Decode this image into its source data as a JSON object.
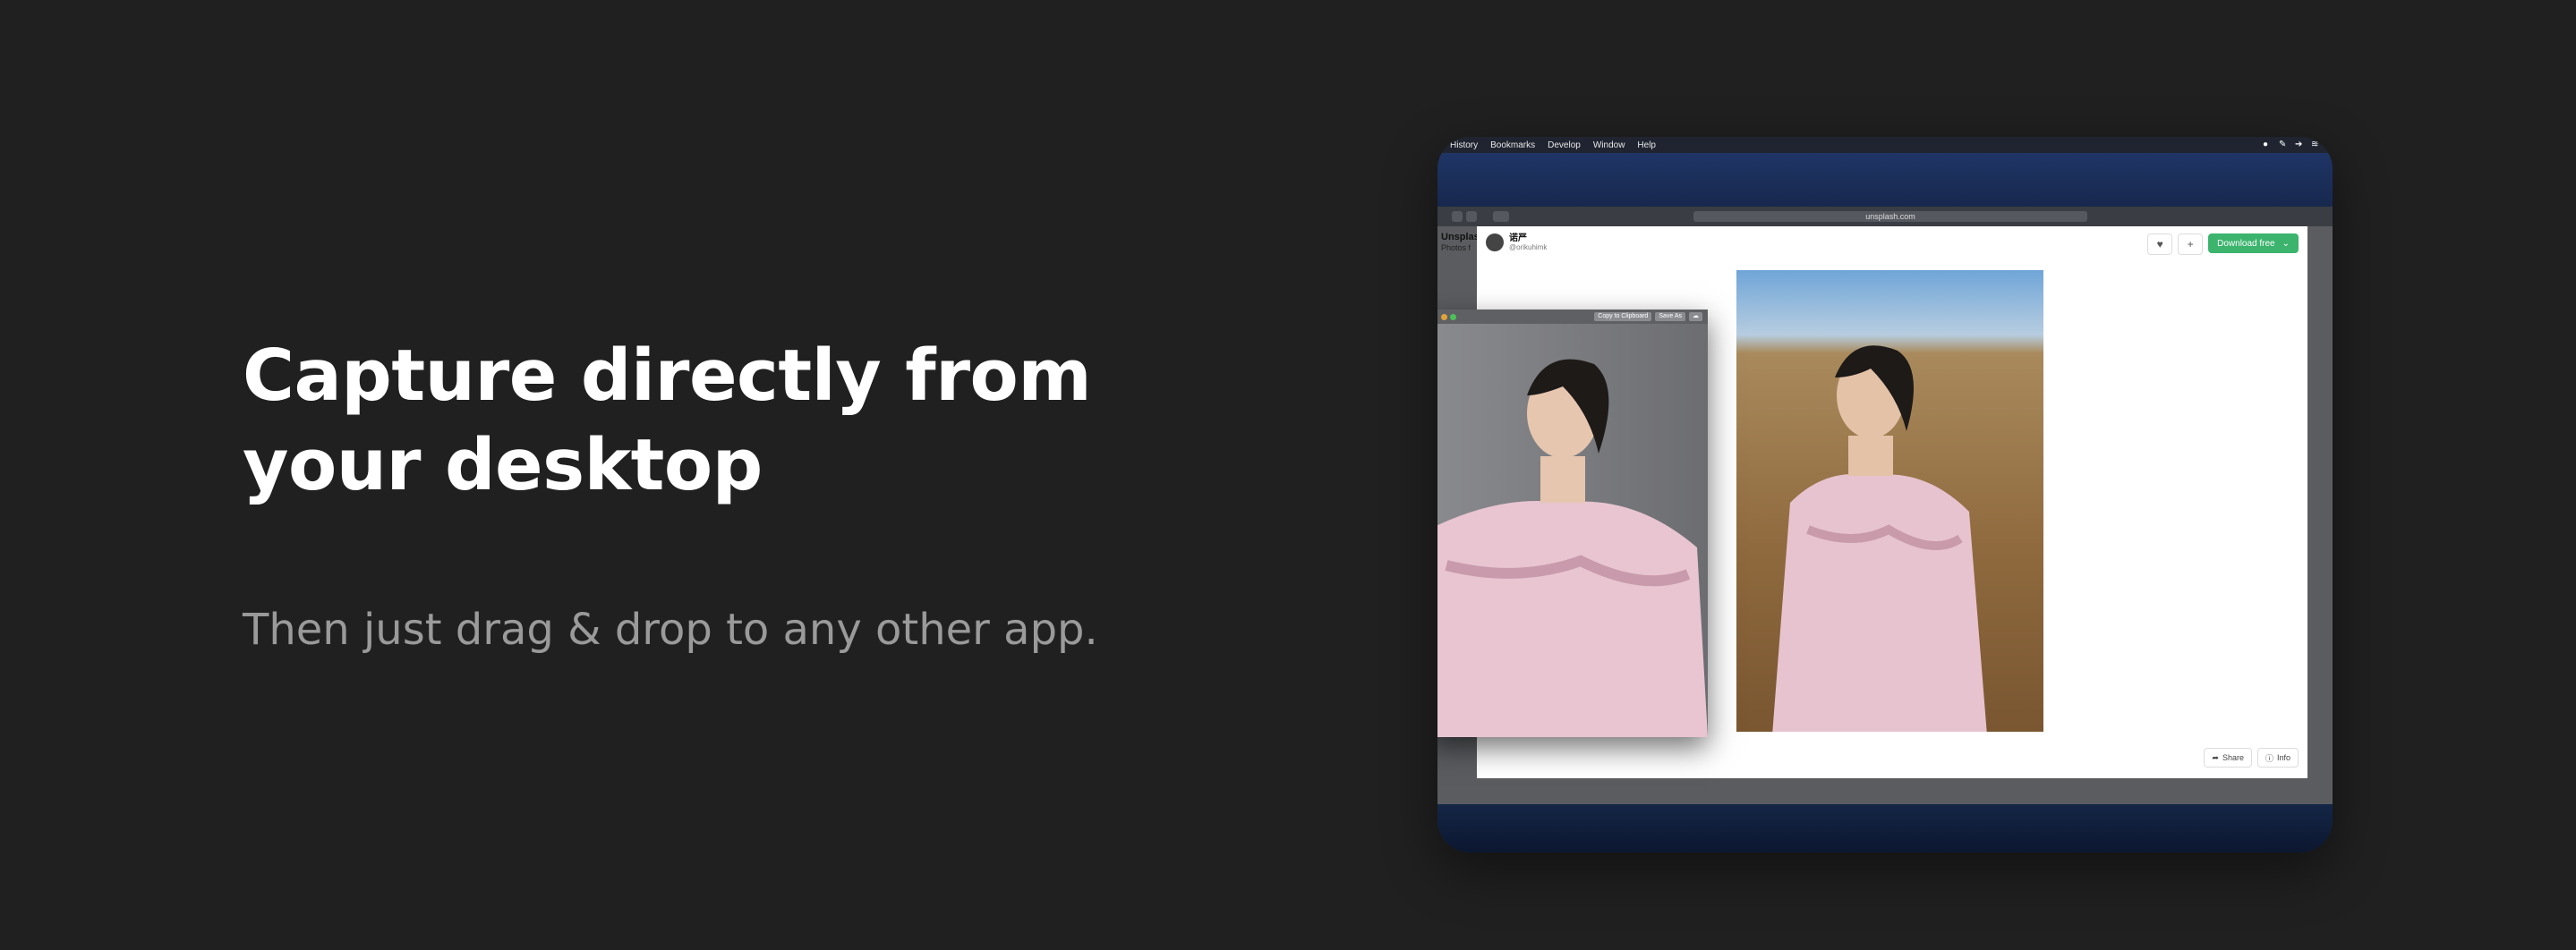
{
  "hero": {
    "title": "Capture directly from your desktop",
    "subtitle": "Then just drag & drop to any other app."
  },
  "screenshot": {
    "menubar": {
      "items": [
        "History",
        "Bookmarks",
        "Develop",
        "Window",
        "Help"
      ]
    },
    "browser": {
      "url": "unsplash.com"
    },
    "page": {
      "site_name": "Unsplash",
      "site_sub": "Photos f"
    },
    "modal": {
      "author_name": "诺严",
      "author_handle": "@orikuhimk",
      "download_label": "Download free",
      "share_label": "Share",
      "info_label": "Info"
    },
    "capture_window": {
      "copy_label": "Copy to Clipboard",
      "save_label": "Save As"
    }
  },
  "colors": {
    "background": "#202020",
    "title": "#ffffff",
    "subtitle": "#9a9a9a",
    "download_button": "#3cb46e"
  }
}
